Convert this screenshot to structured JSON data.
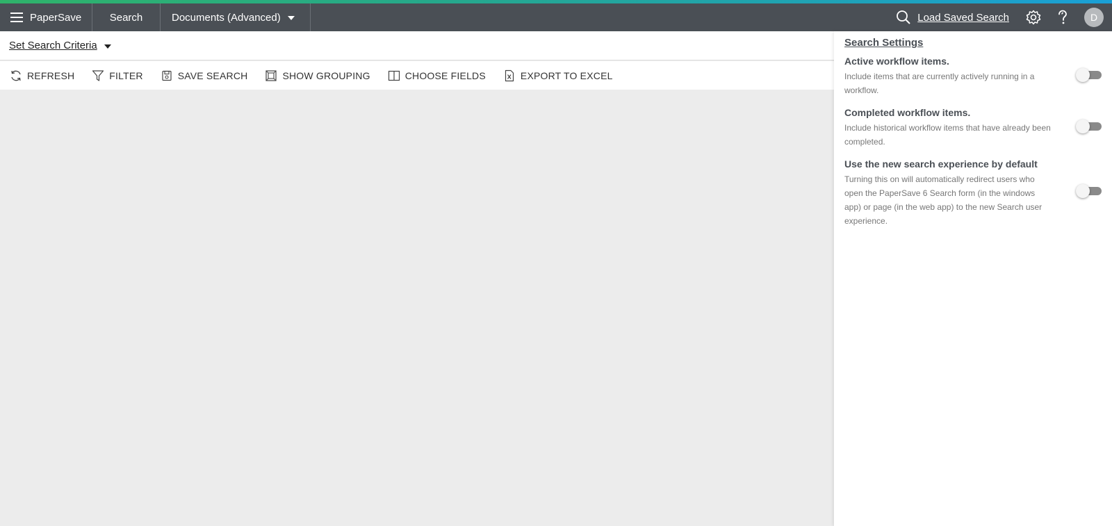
{
  "app": {
    "brand": "PaperSave",
    "search_tab": "Search",
    "doc_tab": "Documents (Advanced)",
    "load_saved_search": "Load Saved Search",
    "avatar_initial": "D",
    "accent_colors": [
      "#2fb36a",
      "#1a9fd6"
    ],
    "topbar_color": "#4a4f55"
  },
  "criteria": {
    "label": "Set Search Criteria"
  },
  "toolbar": {
    "items": [
      {
        "label": "REFRESH",
        "icon": "refresh-icon"
      },
      {
        "label": "FILTER",
        "icon": "filter-icon"
      },
      {
        "label": "SAVE SEARCH",
        "icon": "save-icon"
      },
      {
        "label": "SHOW GROUPING",
        "icon": "grouping-icon"
      },
      {
        "label": "CHOOSE FIELDS",
        "icon": "columns-icon"
      },
      {
        "label": "EXPORT TO EXCEL",
        "icon": "excel-icon"
      }
    ]
  },
  "settings": {
    "title": "Search Settings",
    "items": [
      {
        "name": "Active workflow items.",
        "desc": "Include items that are currently actively running in a workflow.",
        "enabled": false
      },
      {
        "name": "Completed workflow items.",
        "desc": "Include historical workflow items that have already been completed.",
        "enabled": false
      },
      {
        "name": "Use the new search experience by default",
        "desc": "Turning this on will automatically redirect users who open the PaperSave 6 Search form (in the windows app) or page (in the web app) to the new Search user experience.",
        "enabled": false
      }
    ]
  }
}
